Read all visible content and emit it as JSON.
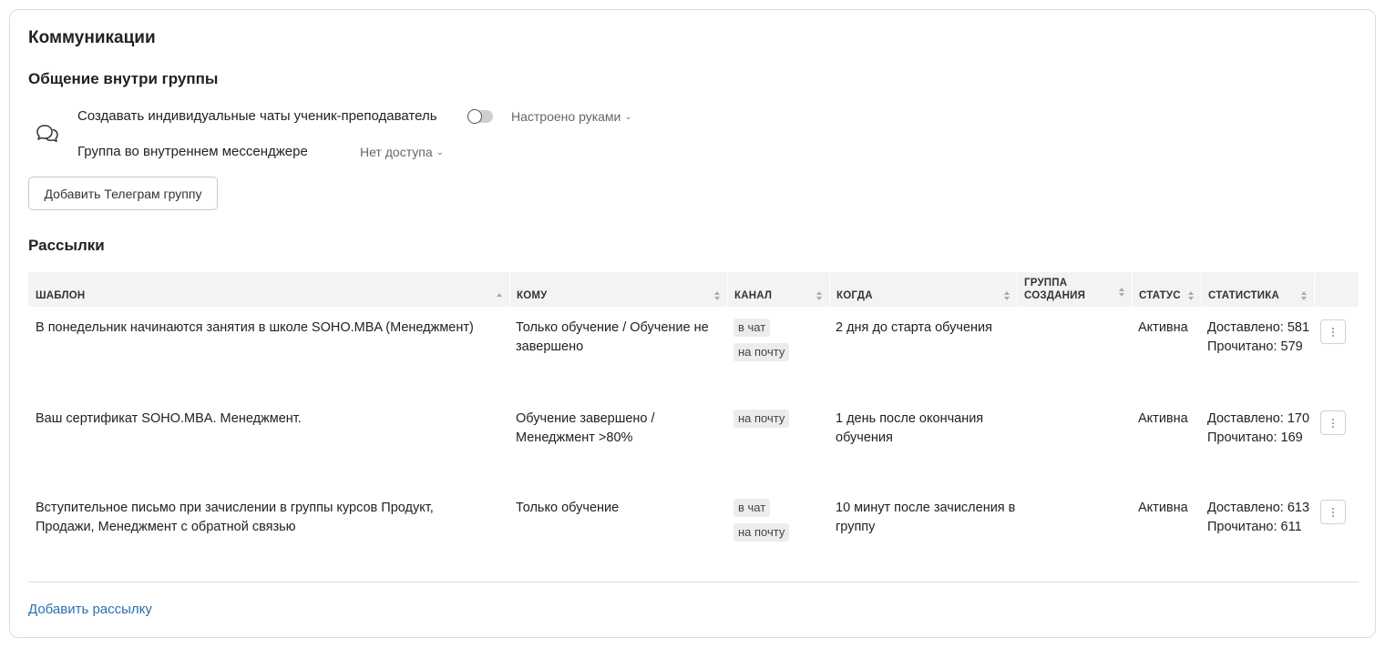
{
  "card": {
    "title": "Коммуникации",
    "group_section": {
      "title": "Общение внутри группы",
      "icon": "chat-bubbles-icon",
      "settings": [
        {
          "label": "Создавать индивидуальные чаты ученик-преподаватель",
          "toggle_on": false,
          "dropdown_value": "Настроено руками"
        },
        {
          "label": "Группа во внутреннем мессенджере",
          "dropdown_value": "Нет доступа"
        }
      ],
      "add_telegram_button": "Добавить Телеграм группу"
    },
    "mailings": {
      "title": "Рассылки",
      "columns": [
        {
          "label": "ШАБЛОН"
        },
        {
          "label": "КОМУ"
        },
        {
          "label": "КАНАЛ"
        },
        {
          "label": "КОГДА"
        },
        {
          "label": "ГРУППА СОЗДАНИЯ"
        },
        {
          "label": "СТАТУС"
        },
        {
          "label": "СТАТИСТИКА"
        }
      ],
      "rows": [
        {
          "template": "В понедельник начинаются занятия в школе SOHO.MBA (Менеджмент)",
          "to": "Только обучение / Обучение не завершено",
          "channels": [
            "в чат",
            "на почту"
          ],
          "when": "2 дня до старта обучения",
          "group": "",
          "status": "Активна",
          "stats": "Доставлено: 581 Прочитано: 579"
        },
        {
          "template": "Ваш сертификат SOHO.MBA. Менеджмент.",
          "to": "Обучение завершено / Менеджмент >80%",
          "channels": [
            "на почту"
          ],
          "when": "1 день после окончания обучения",
          "group": "",
          "status": "Активна",
          "stats": "Доставлено: 170 Прочитано: 169"
        },
        {
          "template": "Вступительное письмо при зачислении в группы курсов Продукт, Продажи, Менеджмент с обратной связью",
          "to": "Только обучение",
          "channels": [
            "в чат",
            "на почту"
          ],
          "when": "10 минут после зачисления в группу",
          "group": "",
          "status": "Активна",
          "stats": "Доставлено: 613 Прочитано: 611"
        }
      ],
      "add_link": "Добавить рассылку"
    }
  }
}
